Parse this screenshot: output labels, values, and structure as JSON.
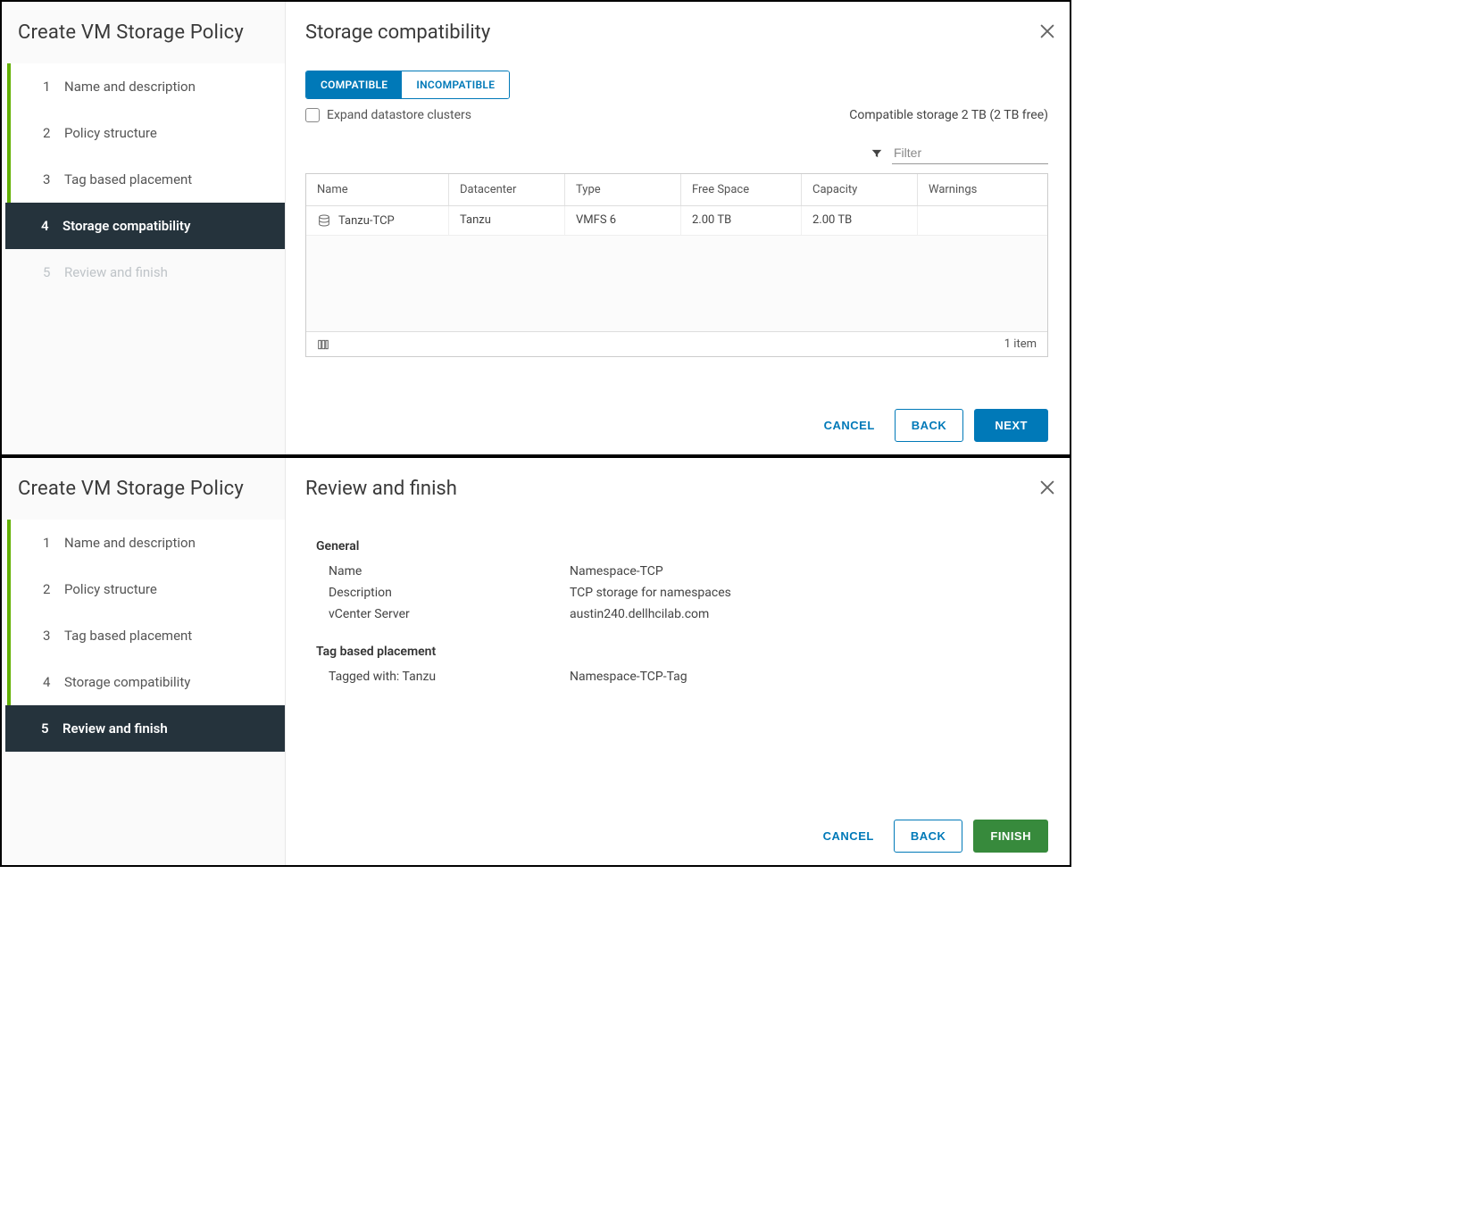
{
  "wizard_title": "Create VM Storage Policy",
  "steps": [
    {
      "num": "1",
      "label": "Name and description"
    },
    {
      "num": "2",
      "label": "Policy structure"
    },
    {
      "num": "3",
      "label": "Tag based placement"
    },
    {
      "num": "4",
      "label": "Storage compatibility"
    },
    {
      "num": "5",
      "label": "Review and finish"
    }
  ],
  "panelA": {
    "title": "Storage compatibility",
    "tabs": {
      "compatible": "COMPATIBLE",
      "incompatible": "INCOMPATIBLE"
    },
    "expand_label": "Expand datastore clusters",
    "summary": "Compatible storage 2 TB (2 TB free)",
    "filter_placeholder": "Filter",
    "columns": {
      "name": "Name",
      "datacenter": "Datacenter",
      "type": "Type",
      "free": "Free Space",
      "capacity": "Capacity",
      "warnings": "Warnings"
    },
    "rows": [
      {
        "name": "Tanzu-TCP",
        "datacenter": "Tanzu",
        "type": "VMFS 6",
        "free": "2.00 TB",
        "capacity": "2.00 TB",
        "warnings": ""
      }
    ],
    "item_count": "1 item",
    "buttons": {
      "cancel": "CANCEL",
      "back": "BACK",
      "next": "NEXT"
    }
  },
  "panelB": {
    "title": "Review and finish",
    "general_head": "General",
    "general": {
      "name_label": "Name",
      "name_value": "Namespace-TCP",
      "desc_label": "Description",
      "desc_value": "TCP storage for namespaces",
      "vc_label": "vCenter Server",
      "vc_value": "austin240.dellhcilab.com"
    },
    "tag_head": "Tag based placement",
    "tag": {
      "tagged_label": "Tagged with: Tanzu",
      "tagged_value": "Namespace-TCP-Tag"
    },
    "buttons": {
      "cancel": "CANCEL",
      "back": "BACK",
      "finish": "FINISH"
    }
  }
}
